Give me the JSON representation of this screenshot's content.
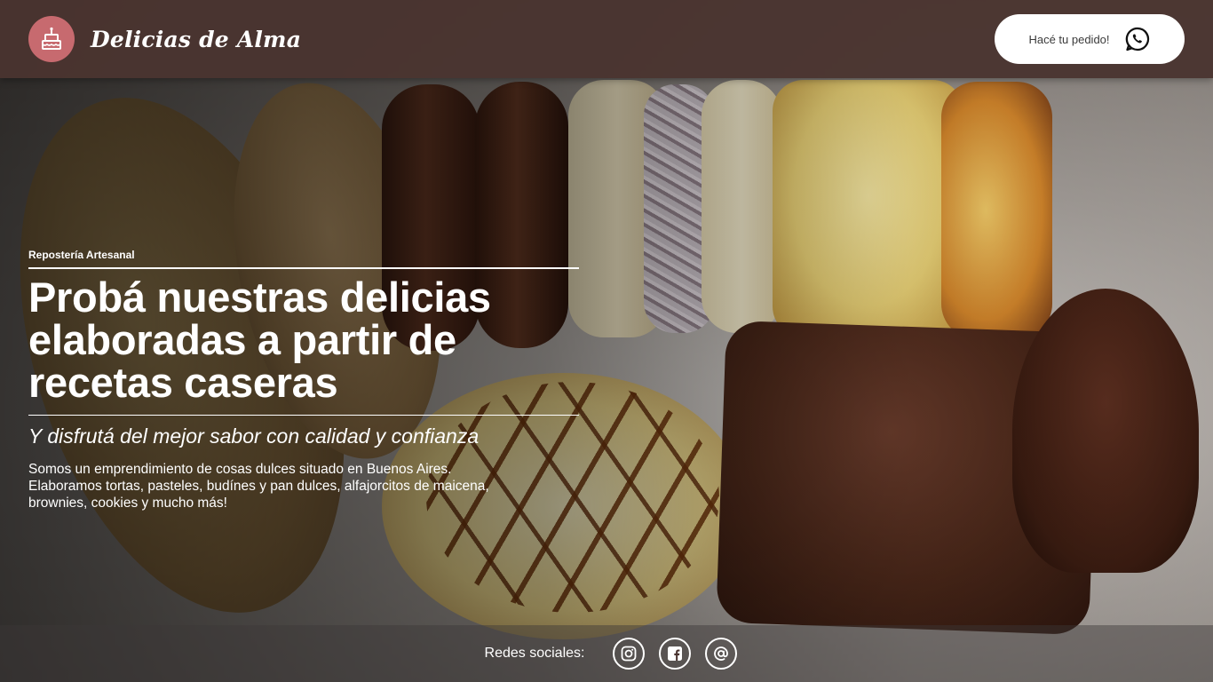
{
  "header": {
    "brand_name": "Delicias de Alma",
    "order_button_label": "Hacé tu pedido!",
    "colors": {
      "bar": "#4a3430",
      "logo_bg": "#c76a6f",
      "button_bg": "#ffffff"
    }
  },
  "hero": {
    "eyebrow": "Repostería Artesanal",
    "title_lines": [
      "Probá nuestras delicias",
      "elaboradas a partir de",
      "recetas caseras"
    ],
    "subtitle": "Y disfrutá del mejor sabor con calidad y confianza",
    "description_lines": [
      "Somos un emprendimiento de cosas dulces situado en Buenos Aires.",
      "Elaboramos tortas, pasteles, budínes y pan dulces, alfajorcitos de maicena,",
      "brownies, cookies y mucho más!"
    ]
  },
  "footer": {
    "social_label": "Redes sociales:",
    "icons": [
      "instagram-icon",
      "facebook-icon",
      "at-sign-icon"
    ]
  }
}
